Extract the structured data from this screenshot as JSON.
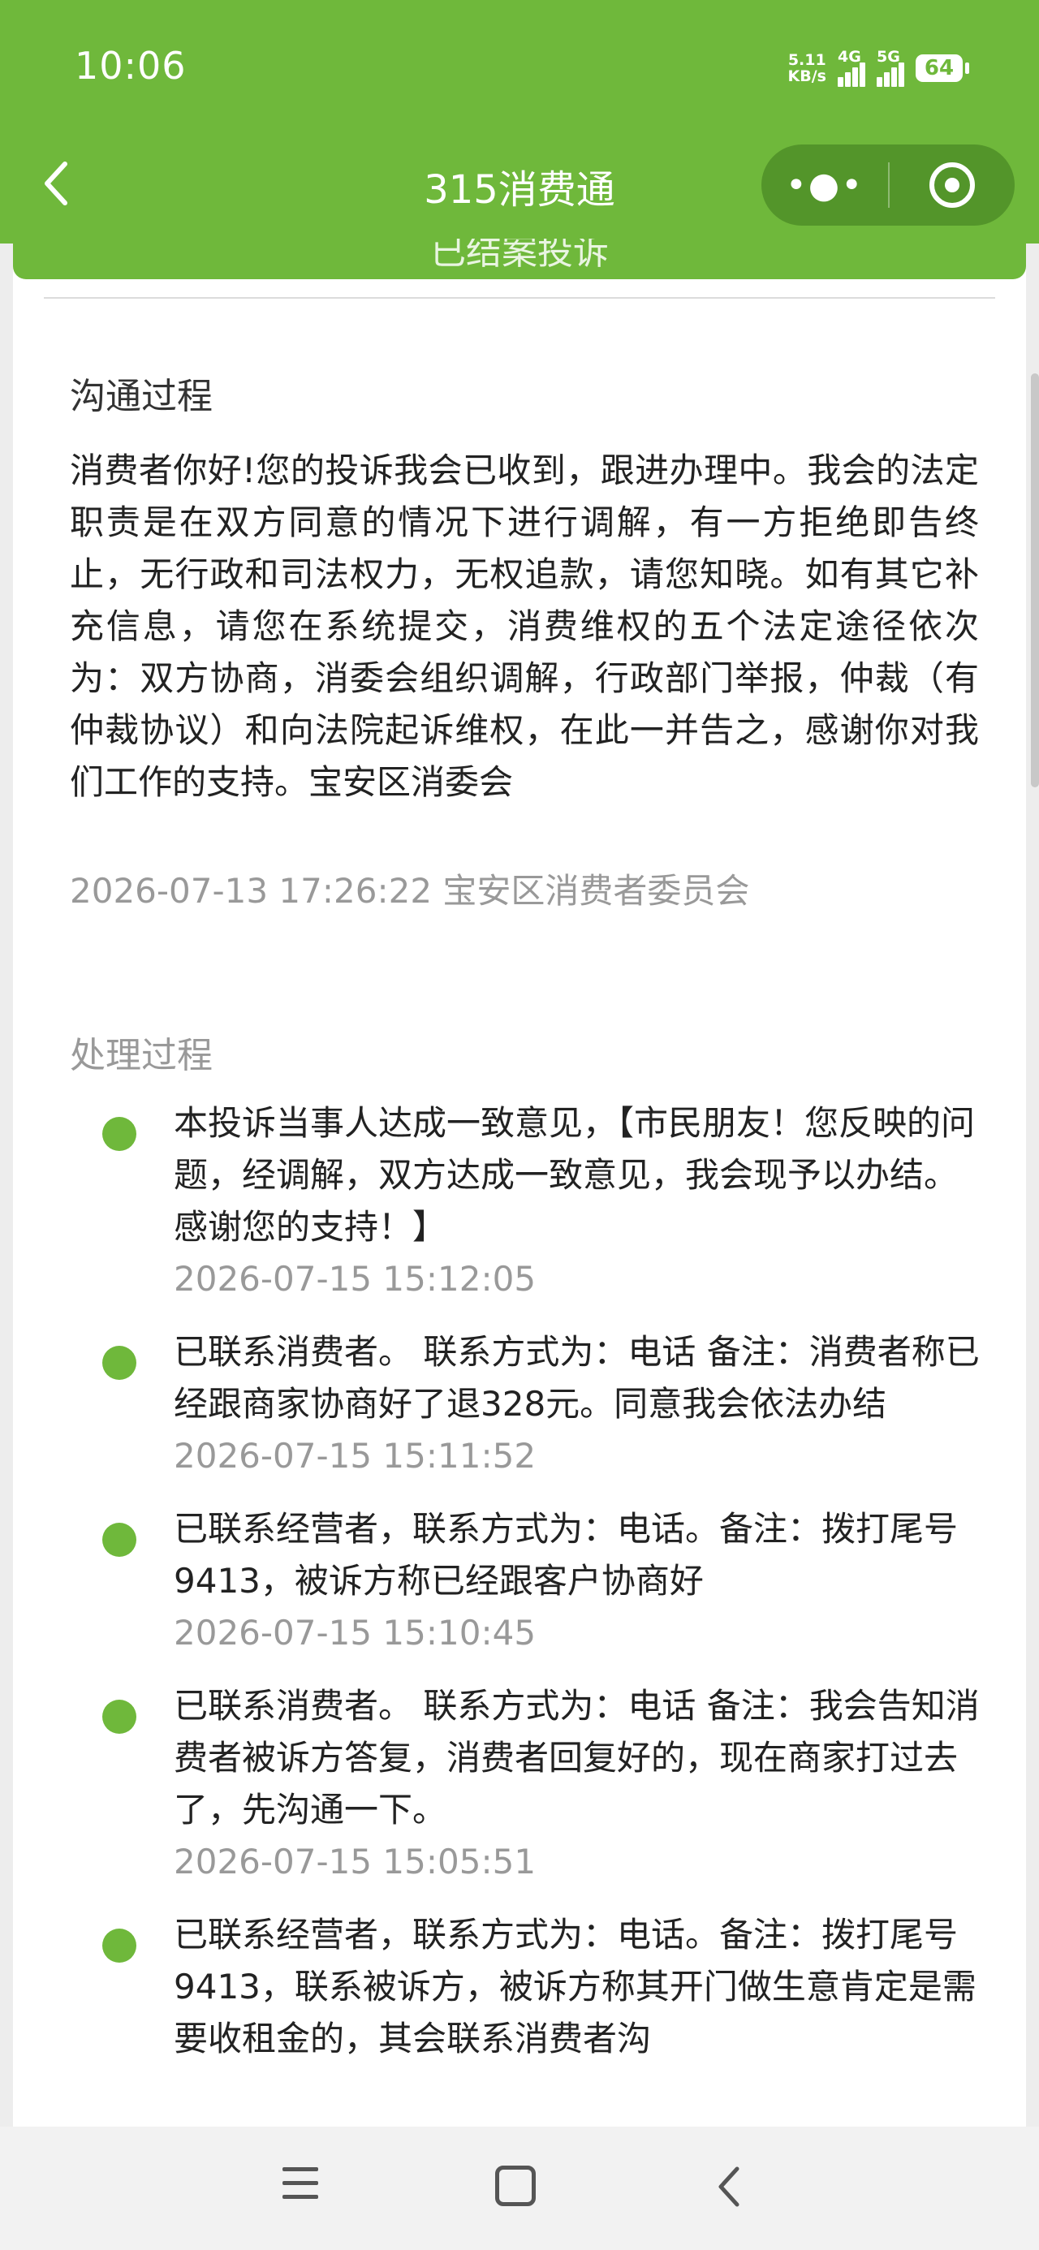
{
  "status_bar": {
    "time": "10:06",
    "net_speed_value": "5.11",
    "net_speed_unit": "KB/s",
    "network_1": "4G",
    "network_2": "5G",
    "battery": "64"
  },
  "header": {
    "title": "315消费通"
  },
  "top_strip": {
    "partial_text": "已结案投诉"
  },
  "communication": {
    "title": "沟通过程",
    "body": "消费者你好!您的投诉我会已收到，跟进办理中。我会的法定职责是在双方同意的情况下进行调解，有一方拒绝即告终止，无行政和司法权力，无权追款，请您知晓。如有其它补充信息，请您在系统提交，消费维权的五个法定途径依次为：双方协商，消委会组织调解，行政部门举报，仲裁（有仲裁协议）和向法院起诉维权，在此一并告之，感谢你对我们工作的支持。宝安区消委会",
    "meta": "2026-07-13 17:26:22 宝安区消费者委员会"
  },
  "processing": {
    "title": "处理过程",
    "items": [
      {
        "text": "本投诉当事人达成一致意见，【市民朋友！您反映的问题，经调解，双方达成一致意见，我会现予以办结。感谢您的支持！】",
        "time": "2026-07-15 15:12:05"
      },
      {
        "text": "已联系消费者。 联系方式为：电话 备注：消费者称已经跟商家协商好了退328元。同意我会依法办结",
        "time": "2026-07-15 15:11:52"
      },
      {
        "text": "已联系经营者，联系方式为：电话。备注：拨打尾号9413，被诉方称已经跟客户协商好",
        "time": "2026-07-15 15:10:45"
      },
      {
        "text": "已联系消费者。 联系方式为：电话 备注：我会告知消费者被诉方答复，消费者回复好的，现在商家打过去了，先沟通一下。",
        "time": "2026-07-15 15:05:51"
      },
      {
        "text": "已联系经营者，联系方式为：电话。备注：拨打尾号9413，联系被诉方，被诉方称其开门做生意肯定是需要收租金的，其会联系消费者沟",
        "time": ""
      }
    ]
  },
  "colors": {
    "brand_green": "#6fb83b",
    "text_gray": "#999999"
  },
  "icons": {
    "back": "chevron-left-icon",
    "more": "more-dots-icon",
    "close": "target-circle-icon",
    "menu": "menu-icon",
    "home": "home-square-icon",
    "sys_back": "back-chevron-icon"
  }
}
